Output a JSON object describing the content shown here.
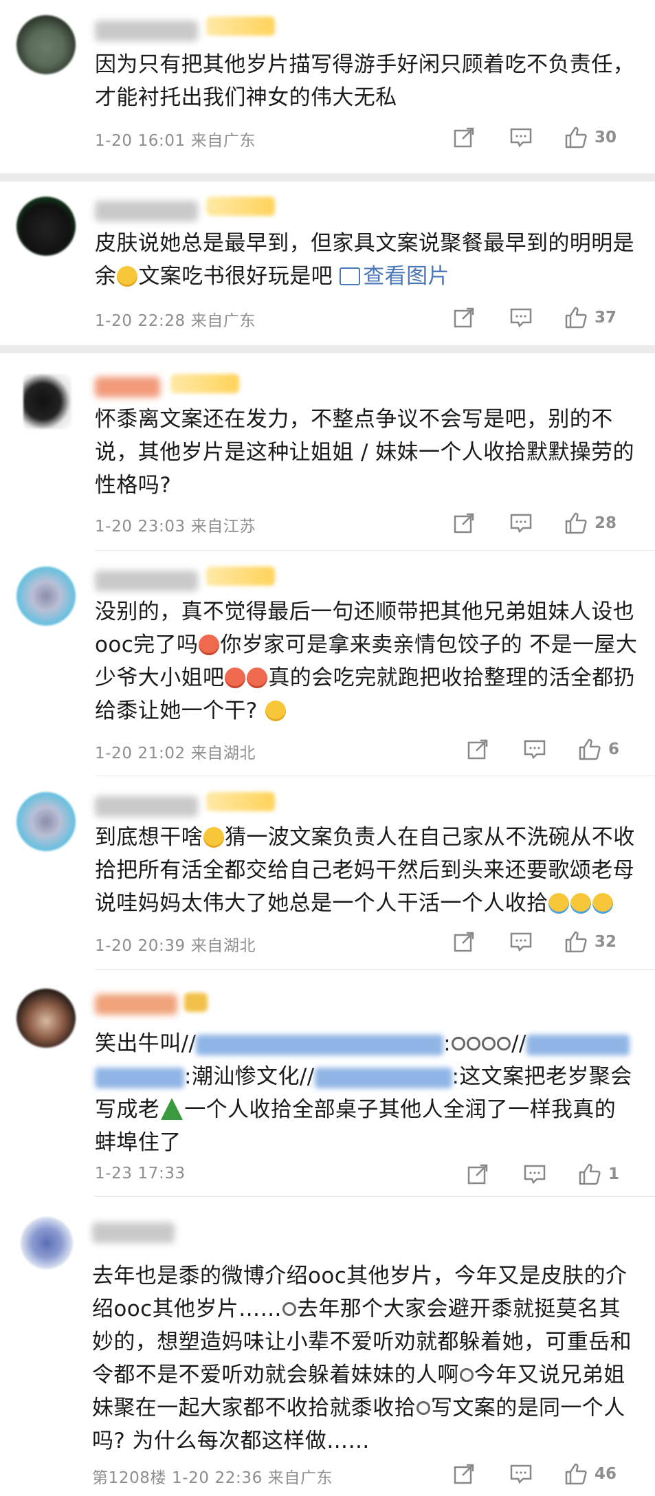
{
  "colors": {
    "link": "#4a78b8",
    "meta": "#8e8e8e",
    "text": "#1a1a1a",
    "separator": "#ececec"
  },
  "icons": {
    "share": "share-icon",
    "reply": "comment-icon",
    "like": "thumbs-up-icon"
  },
  "comments": [
    {
      "lines": [
        "因为只有把其他岁片描写得游手好闲只顾着吃不负责任，",
        "才能衬托出我们神女的伟大无私"
      ],
      "meta": "1-20 16:01 来自广东",
      "likes": "30"
    },
    {
      "lines": [
        "皮肤说她总是最早到，但家具文案说聚餐最早到的明明是",
        "余",
        "文案吃书很好玩是吧 ",
        "查看图片"
      ],
      "meta": "1-20 22:28 来自广东",
      "likes": "37"
    },
    {
      "lines": [
        "怀黍离文案还在发力，不整点争议不会写是吧，别的不",
        "说，其他岁片是这种让姐姐 / 妹妹一个人收拾默默操劳的",
        "性格吗?"
      ],
      "meta": "1-20 23:03 来自江苏",
      "likes": "28"
    },
    {
      "lines": [
        "没别的，真不觉得最后一句还顺带把其他兄弟姐妹人设也",
        "ooc完了吗",
        "你岁家可是拿来卖亲情包饺子的 不是一屋大",
        "少爷大小姐吧",
        "真的会吃完就跑把收拾整理的活全都扔",
        "给黍让她一个干?"
      ],
      "meta": "1-20 21:02 来自湖北",
      "likes": "6"
    },
    {
      "lines": [
        "到底想干啥",
        "猜一波文案负责人在自己家从不洗碗从不收",
        "拾把所有活全都交给自己老妈干然后到头来还要歌颂老母",
        "说哇妈妈太伟大了她总是一个人干活一个人收拾"
      ],
      "meta": "1-20 20:39 来自湖北",
      "likes": "32"
    },
    {
      "lines": [
        "笑出牛叫//",
        ":",
        "//",
        ":潮汕惨文化//",
        ":这文案把老岁聚会",
        "写成老",
        "一个人收拾全部桌子其他人全润了一样我真的",
        "蚌埠住了"
      ],
      "meta": "1-23 17:33",
      "likes": "1"
    },
    {
      "lines": [
        "去年也是黍的微博介绍ooc其他岁片，今年又是皮肤的介",
        "绍ooc其他岁片……",
        "去年那个大家会避开黍就挺莫名其",
        "妙的，想塑造妈味让小辈不爱听劝就都躲着她，可重岳和",
        "令都不是不爱听劝就会躲着妹妹的人啊",
        "今年又说兄弟姐",
        "妹聚在一起大家都不收拾就黍收拾",
        "写文案的是同一个人",
        "吗? 为什么每次都这样做……"
      ],
      "meta": "第1208楼 1-20 22:36 来自广东",
      "likes": "46"
    }
  ]
}
